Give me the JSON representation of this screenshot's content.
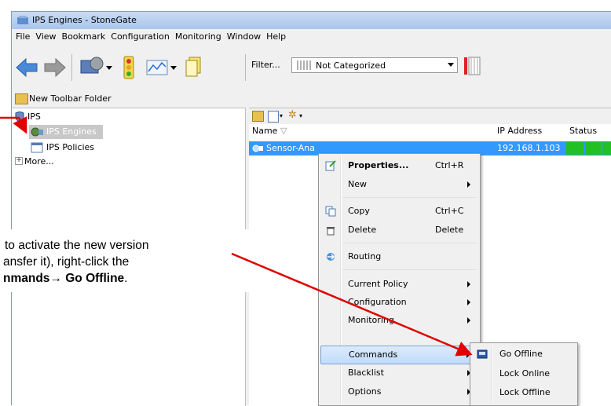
{
  "window": {
    "title": "IPS Engines - StoneGate"
  },
  "menu": [
    "File",
    "View",
    "Bookmark",
    "Configuration",
    "Monitoring",
    "Window",
    "Help"
  ],
  "toolbar": {
    "filter_label": "Filter...",
    "filter_value": "Not Categorized",
    "new_folder_label": "New Toolbar Folder"
  },
  "tree": {
    "root": "IPS",
    "items": [
      {
        "label": "IPS Engines"
      },
      {
        "label": "IPS Policies"
      },
      {
        "label": "More..."
      }
    ]
  },
  "table": {
    "headers": [
      "Name",
      "IP Address",
      "Status"
    ],
    "row": {
      "name": "Sensor-Ana",
      "ip": "192.168.1.103"
    }
  },
  "context_menu": {
    "items": [
      {
        "label": "Properties...",
        "shortcut": "Ctrl+R",
        "icon": "properties-icon"
      },
      {
        "label": "New",
        "submenu": true
      },
      {
        "label": "Copy",
        "shortcut": "Ctrl+C",
        "icon": "copy-icon"
      },
      {
        "label": "Delete",
        "shortcut": "Delete",
        "icon": "delete-icon"
      },
      {
        "label": "Routing",
        "icon": "routing-icon"
      },
      {
        "label": "Current Policy",
        "submenu": true
      },
      {
        "label": "Configuration",
        "submenu": true
      },
      {
        "label": "Monitoring",
        "submenu": true
      },
      {
        "label": "Commands",
        "submenu": true
      },
      {
        "label": "Blacklist",
        "submenu": true
      },
      {
        "label": "Options",
        "submenu": true
      }
    ]
  },
  "submenu": {
    "items": [
      {
        "label": "Go Offline",
        "icon": "go-offline-icon"
      },
      {
        "label": "Lock Online"
      },
      {
        "label": "Lock Offline"
      }
    ]
  },
  "callout": {
    "line1": "to activate the new version",
    "line2": "ansfer it), right-click the",
    "line3_bold1": "nmands",
    "line3_arrow": "→",
    "line3_bold2": "Go Offline",
    "line3_end": "."
  },
  "colors": {
    "selection": "#3399ff",
    "status_ok": "#22c022",
    "callout_arrow": "#e00000"
  }
}
